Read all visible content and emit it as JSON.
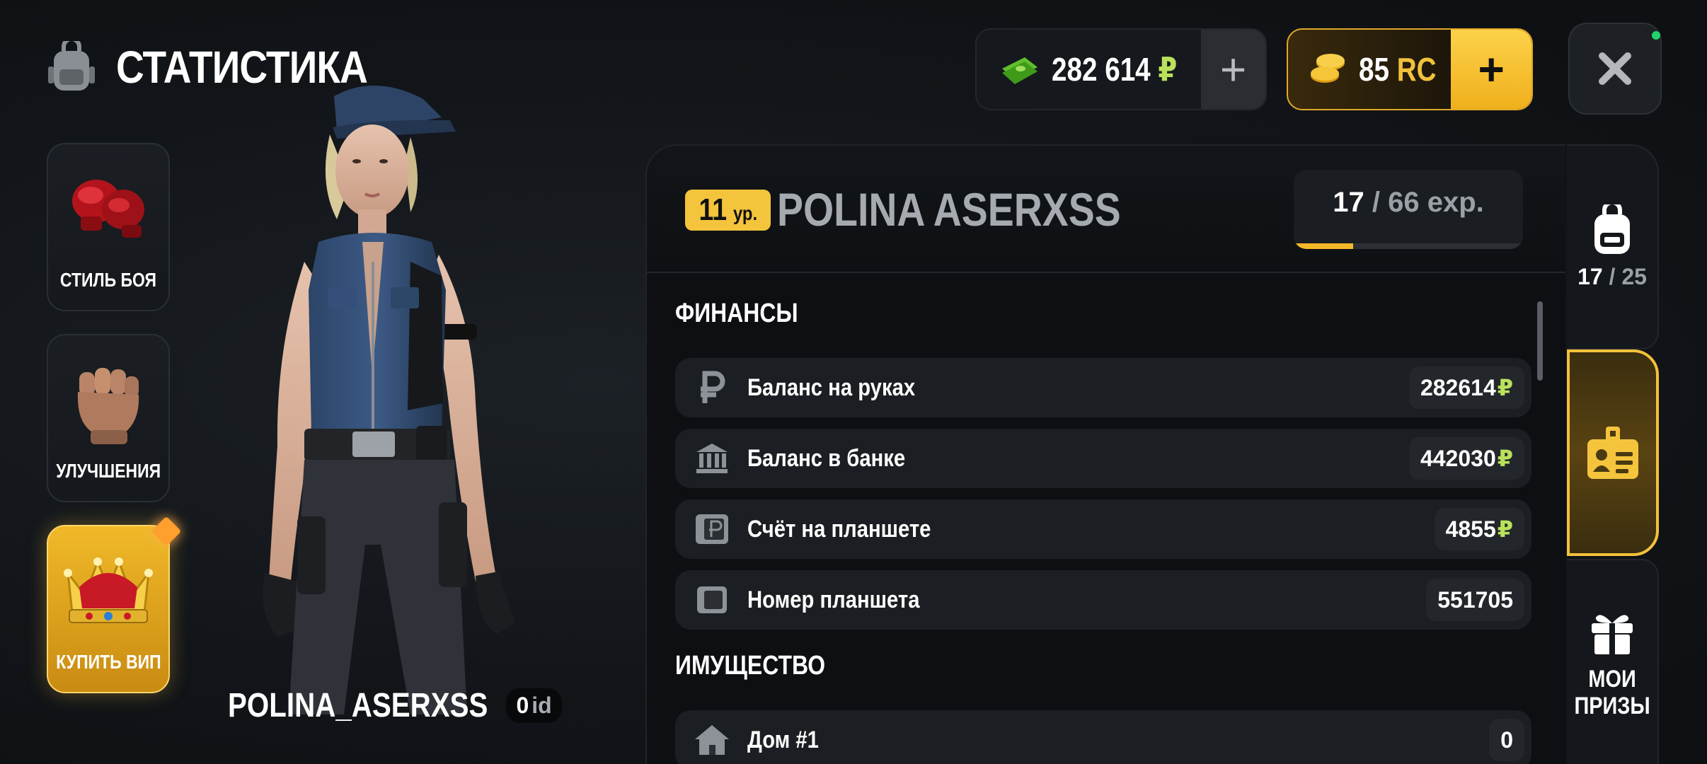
{
  "header": {
    "title": "СТАТИСТИКА",
    "icon": "backpack-icon"
  },
  "side_menu": [
    {
      "label": "СТИЛЬ БОЯ",
      "icon": "boxing-gloves-icon"
    },
    {
      "label": "УЛУЧШЕНИЯ",
      "icon": "fist-icon"
    },
    {
      "label": "КУПИТЬ ВИП",
      "icon": "crown-icon"
    }
  ],
  "character": {
    "name": "POLINA_ASERXSS",
    "id_value": "0",
    "id_label": "id"
  },
  "currency": {
    "money_value": "282 614",
    "money_symbol": "₽",
    "rc_value": "85",
    "rc_symbol": "RC",
    "plus": "+"
  },
  "profile": {
    "level_number": "11",
    "level_suffix": "ур.",
    "player_name": "POLINA ASERXSS",
    "exp_current": "17",
    "exp_rest": " / 66 exp.",
    "exp_progress": 0.26
  },
  "finances": {
    "title": "ФИНАНСЫ",
    "rows": [
      {
        "label": "Баланс на руках",
        "value": "282614",
        "currency": "₽",
        "icon": "ruble-icon"
      },
      {
        "label": "Баланс в банке",
        "value": "442030",
        "currency": "₽",
        "icon": "bank-icon"
      },
      {
        "label": "Счёт на планшете",
        "value": "4855",
        "currency": "₽",
        "icon": "tablet-wallet-icon"
      },
      {
        "label": "Номер планшета",
        "value": "551705",
        "currency": "",
        "icon": "tablet-icon"
      }
    ]
  },
  "property": {
    "title": "ИМУЩЕСТВО",
    "rows": [
      {
        "label": "Дом #1",
        "value": "0",
        "icon": "house-icon"
      }
    ]
  },
  "right_tabs": {
    "inventory_count": "17",
    "inventory_total": " / 25",
    "prizes_line1": "МОИ",
    "prizes_line2": "ПРИЗЫ"
  },
  "colors": {
    "accent_gold": "#f4c43c",
    "money_green": "#b9e25c",
    "panel_bg": "#0d0f12",
    "row_bg": "#1b1e22"
  }
}
